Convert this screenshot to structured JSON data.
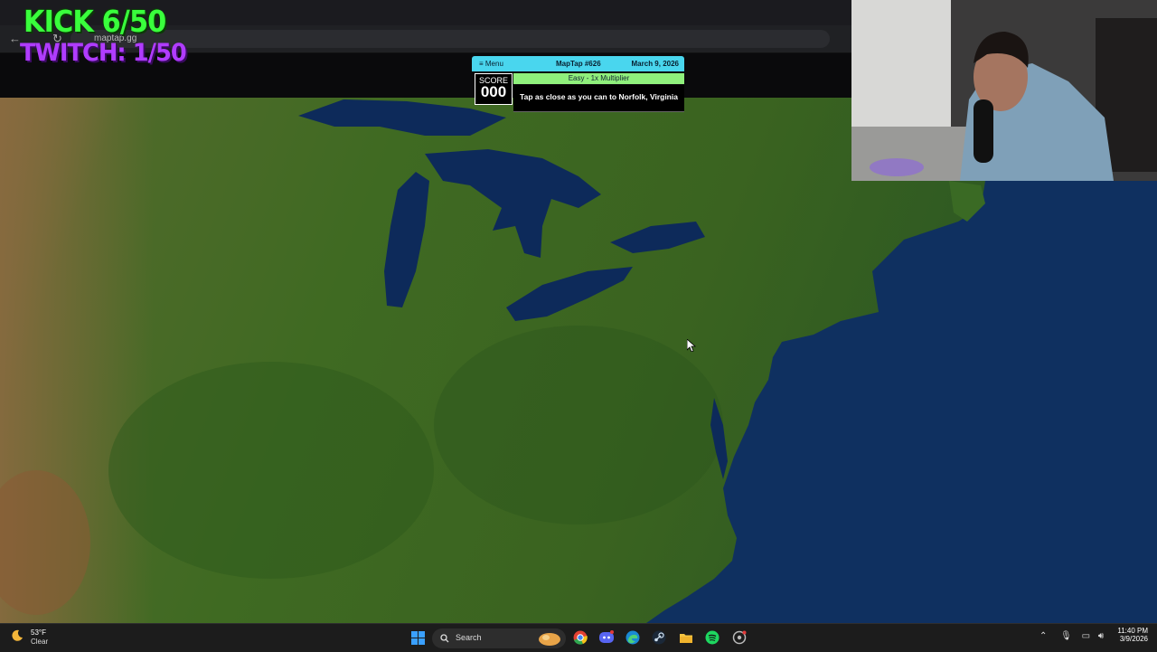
{
  "stream_overlay": {
    "kick": "KICK 6/50",
    "twitch": "TWITCH: 1/50"
  },
  "browser": {
    "url": "maptap.gg"
  },
  "game": {
    "menu_label": "≡ Menu",
    "title": "MapTap #626",
    "date": "March 9, 2026",
    "score_label": "SCORE",
    "score_value": "000",
    "multiplier": "Easy - 1x Multiplier",
    "prompt": "Tap as close as you can to Norfolk, Virginia"
  },
  "taskbar": {
    "weather_temp": "53°F",
    "weather_desc": "Clear",
    "search_label": "Search",
    "time": "11:40 PM",
    "date": "3/9/2026",
    "pinned": [
      "start-icon",
      "chrome-icon",
      "discord-icon",
      "edge-icon",
      "steam-icon",
      "file-explorer-icon",
      "spotify-icon",
      "app-icon"
    ]
  },
  "colors": {
    "land": "#3d6a22",
    "ocean": "#0f3060",
    "hud_header": "#49d6ee",
    "multiplier_bg": "#8ff07c",
    "kick_green": "#39ff3c",
    "twitch_purple": "#b03cff"
  }
}
